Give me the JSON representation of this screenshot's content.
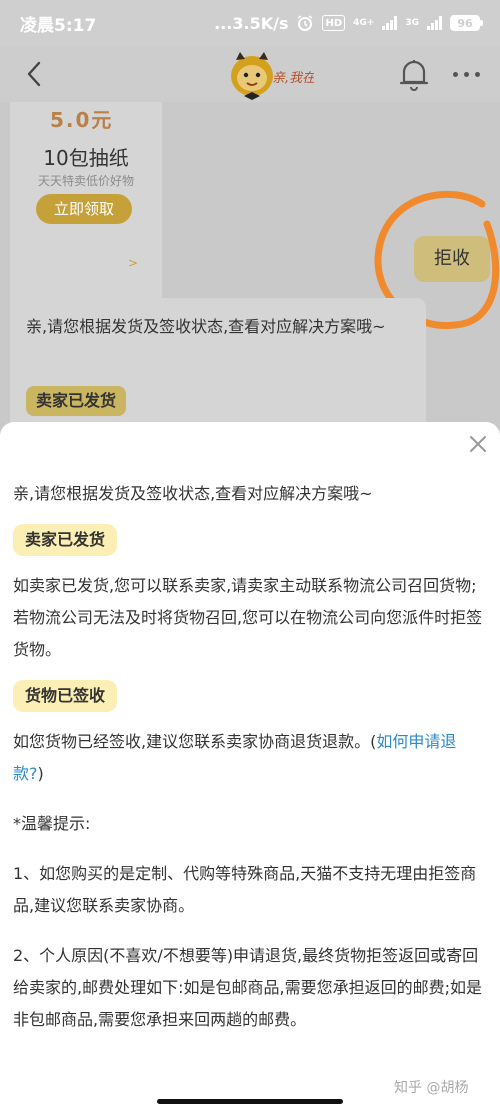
{
  "status_bar": {
    "time": "凌晨5:17",
    "net_speed": "...3.5K/s",
    "hd": "HD",
    "network_type_1": "4G+",
    "network_type_2": "3G",
    "battery": "96"
  },
  "nav": {
    "logo_text": "亲,我在"
  },
  "chat": {
    "promo": {
      "price": "5.0元",
      "title": "10包抽纸",
      "subtitle": "天天特卖低价好物",
      "button": "立即领取",
      "arrow": ">"
    },
    "user_bubble": "拒收",
    "bot_bubble": {
      "text": "亲,请您根据发货及签收状态,查看对应解决方案哦~",
      "tag": "卖家已发货"
    }
  },
  "sheet": {
    "intro": "亲,请您根据发货及签收状态,查看对应解决方案哦~",
    "section1": {
      "tag": "卖家已发货",
      "text": "如卖家已发货,您可以联系卖家,请卖家主动联系物流公司召回货物;若物流公司无法及时将货物召回,您可以在物流公司向您派件时拒签货物。"
    },
    "section2": {
      "tag": "货物已签收",
      "text_before": "如您货物已经签收,建议您联系卖家协商退货退款。(",
      "link": "如何申请退款?",
      "text_after": ")"
    },
    "tips_title": "*温馨提示:",
    "tip1": "1、如您购买的是定制、代购等特殊商品,天猫不支持无理由拒签商品,建议您联系卖家协商。",
    "tip2": "2、个人原因(不喜欢/不想要等)申请退货,最终货物拒签返回或寄回给卖家的,邮费处理如下:如是包邮商品,需要您承担返回的邮费;如是非包邮商品,需要您承担来回两趟的邮费。"
  },
  "watermark": "知乎 @胡杨",
  "colors": {
    "promo_button": "#c6a139",
    "user_bubble": "#cfbd7b",
    "tag_bg": "#fcefb5",
    "link": "#2c8ac8",
    "annotation_circle": "#f08a2c"
  }
}
